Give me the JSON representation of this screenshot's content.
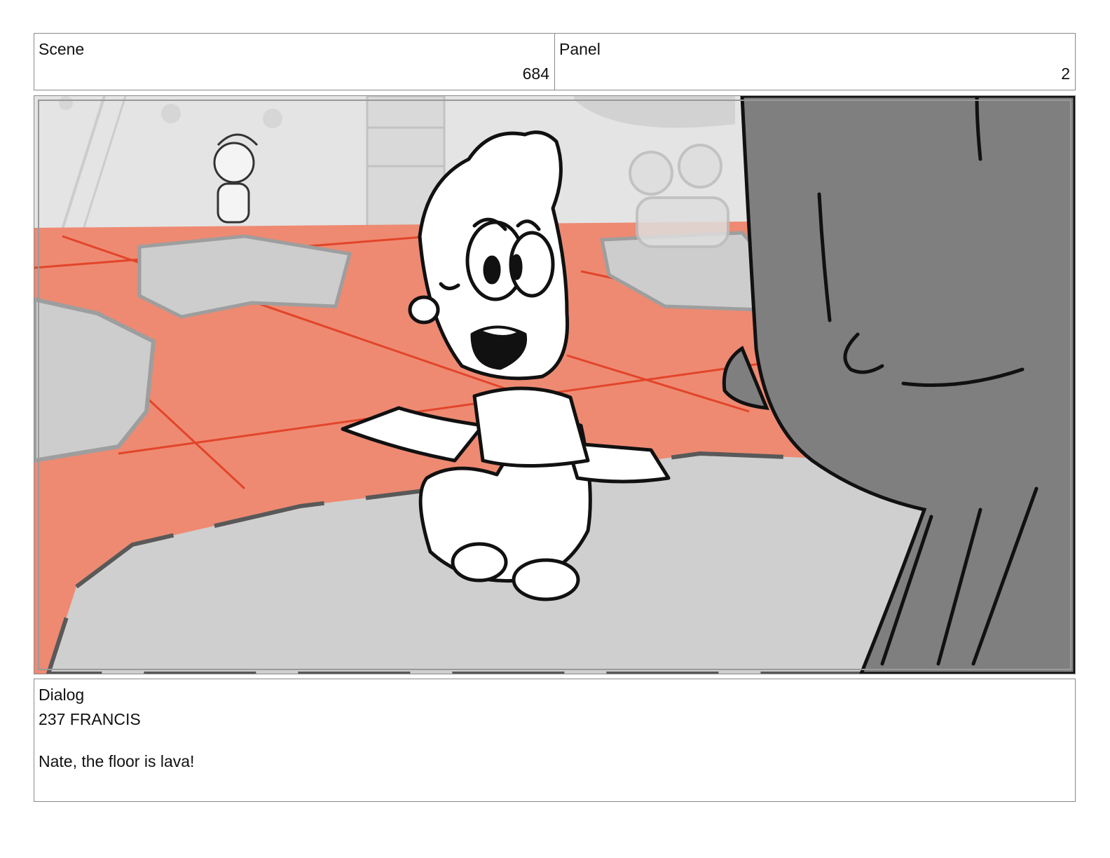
{
  "header": {
    "scene_label": "Scene",
    "scene_number": "684",
    "panel_label": "Panel",
    "panel_number": "2"
  },
  "dialog": {
    "label": "Dialog",
    "speaker": "237 FRANCIS",
    "line": "Nate, the floor is lava!"
  },
  "colors": {
    "lava": "#ee8a72",
    "lava_lines": "#e2452a",
    "floor": "#cfcfcf",
    "wall": "#e4e4e4",
    "foreground_character": "#7f7f7f"
  }
}
